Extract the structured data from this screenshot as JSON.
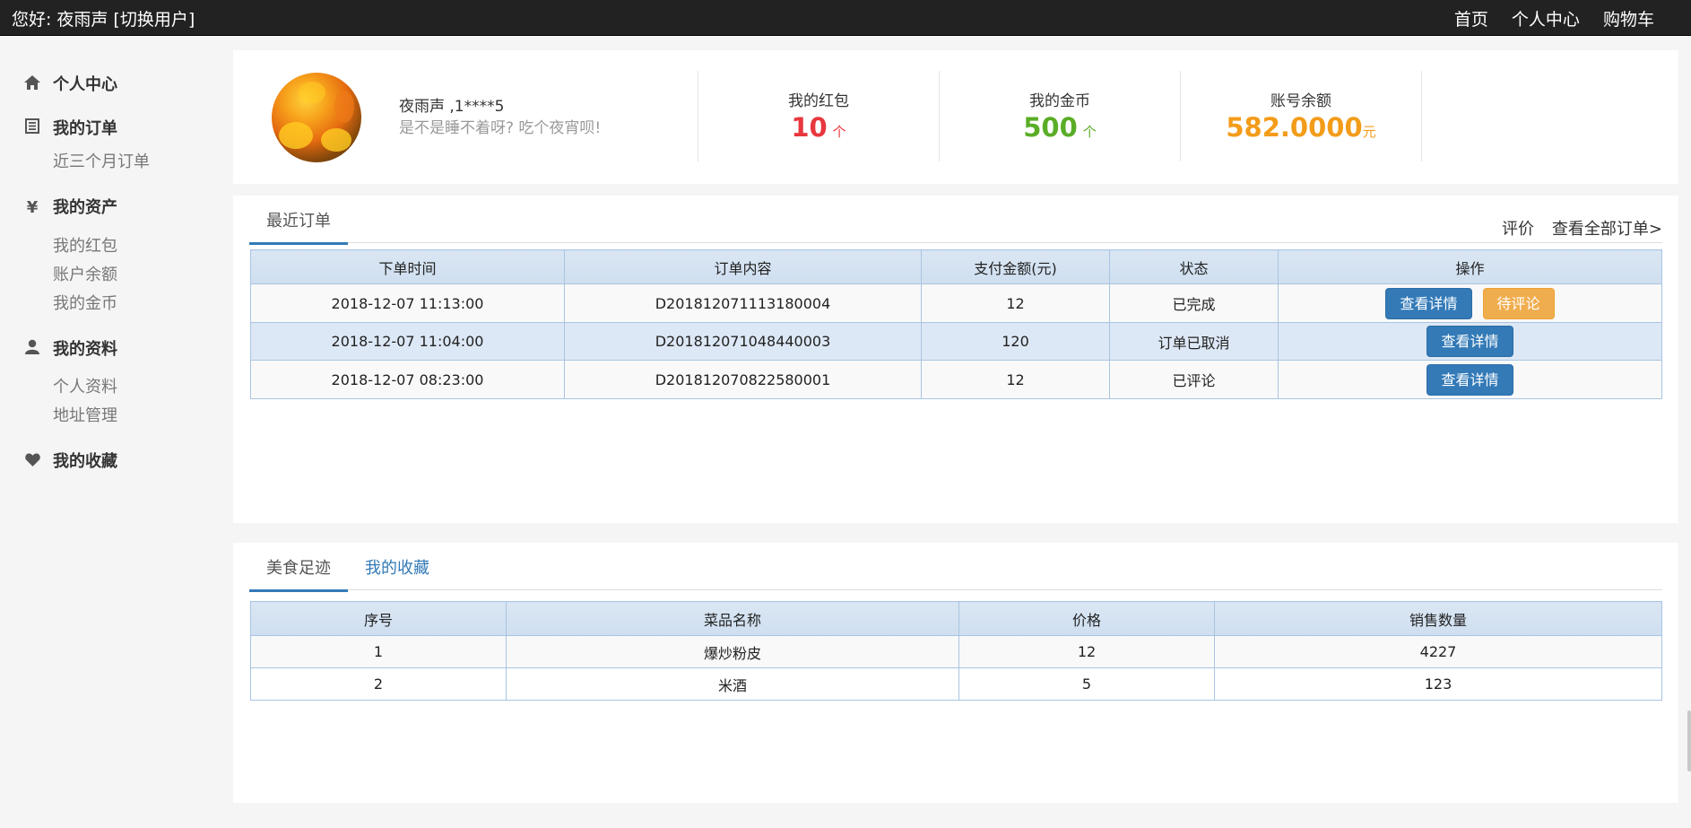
{
  "topbar": {
    "greeting": "您好:",
    "username": "夜雨声",
    "switch_user": "[切换用户]",
    "nav": [
      "首页",
      "个人中心",
      "购物车"
    ]
  },
  "sidebar": {
    "sections": [
      {
        "label": "个人中心",
        "icon": "home-icon",
        "items": []
      },
      {
        "label": "我的订单",
        "icon": "list-icon",
        "items": [
          "近三个月订单"
        ]
      },
      {
        "label": "我的资产",
        "icon": "yen-icon",
        "items": [
          "我的红包",
          "账户余额",
          "我的金币"
        ]
      },
      {
        "label": "我的资料",
        "icon": "user-icon",
        "items": [
          "个人资料",
          "地址管理"
        ]
      },
      {
        "label": "我的收藏",
        "icon": "heart-icon",
        "items": []
      }
    ]
  },
  "profile": {
    "name": "夜雨声 ,1****5",
    "quote": "是不是睡不着呀? 吃个夜宵呗!"
  },
  "stats": [
    {
      "label": "我的红包",
      "value": "10",
      "unit": "个",
      "color": "#e8373e"
    },
    {
      "label": "我的金币",
      "value": "500",
      "unit": "个",
      "color": "#5aad26"
    },
    {
      "label": "账号余额",
      "value": "582.0000",
      "unit": "元",
      "color": "#f39c1a"
    }
  ],
  "orders": {
    "tab": "最近订单",
    "actions": [
      "评价",
      "查看全部订单>"
    ],
    "columns": [
      "下单时间",
      "订单内容",
      "支付金额(元)",
      "状态",
      "操作"
    ],
    "rows": [
      {
        "time": "2018-12-07 11:13:00",
        "content": "D201812071113180004",
        "amount": "12",
        "status": "已完成",
        "buttons": [
          "查看详情",
          "待评论"
        ]
      },
      {
        "time": "2018-12-07 11:04:00",
        "content": "D201812071048440003",
        "amount": "120",
        "status": "订单已取消",
        "buttons": [
          "查看详情"
        ]
      },
      {
        "time": "2018-12-07 08:23:00",
        "content": "D201812070822580001",
        "amount": "12",
        "status": "已评论",
        "buttons": [
          "查看详情"
        ]
      }
    ]
  },
  "footprint": {
    "tabs": [
      "美食足迹",
      "我的收藏"
    ],
    "columns": [
      "序号",
      "菜品名称",
      "价格",
      "销售数量"
    ],
    "rows": [
      {
        "no": "1",
        "name": "爆炒粉皮",
        "price": "12",
        "sales": "4227"
      },
      {
        "no": "2",
        "name": "米酒",
        "price": "5",
        "sales": "123"
      }
    ]
  }
}
